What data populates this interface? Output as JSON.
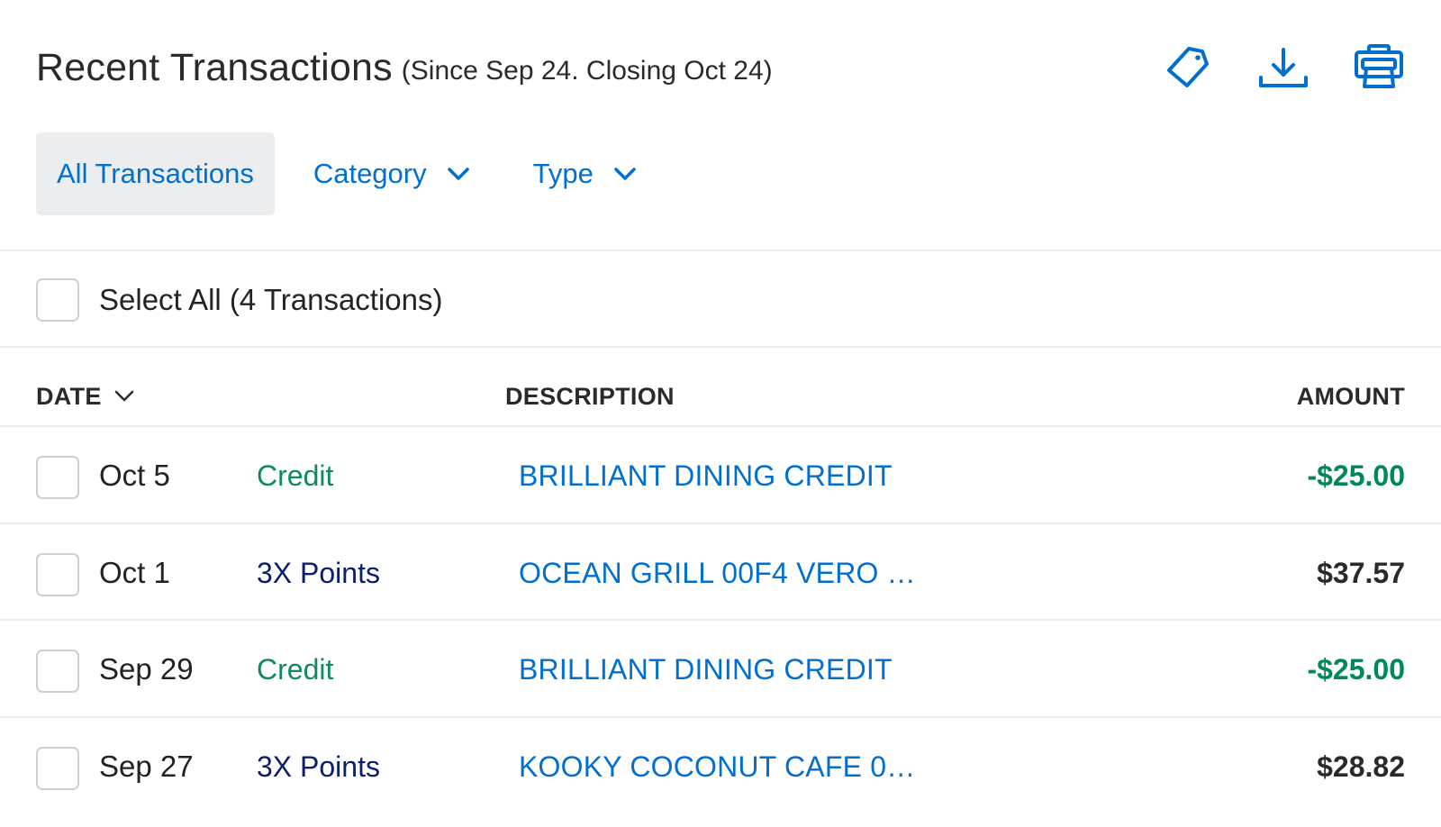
{
  "header": {
    "title": "Recent Transactions",
    "subtitle": "(Since Sep 24. Closing Oct 24)",
    "actions": [
      {
        "name": "tag-icon",
        "label": "Tag"
      },
      {
        "name": "download-icon",
        "label": "Download"
      },
      {
        "name": "print-icon",
        "label": "Print"
      }
    ]
  },
  "filters": {
    "all": "All Transactions",
    "category": "Category",
    "type": "Type"
  },
  "select_all": {
    "label": "Select All (4 Transactions)"
  },
  "table": {
    "columns": {
      "date": "DATE",
      "description": "DESCRIPTION",
      "amount": "AMOUNT"
    },
    "rows": [
      {
        "date": "Oct 5",
        "type": "Credit",
        "type_kind": "credit",
        "description": "BRILLIANT DINING CREDIT",
        "amount": "-$25.00",
        "amount_kind": "credit"
      },
      {
        "date": "Oct 1",
        "type": "3X Points",
        "type_kind": "points",
        "description": "OCEAN GRILL 00F4 VERO …",
        "amount": "$37.57",
        "amount_kind": "debit"
      },
      {
        "date": "Sep 29",
        "type": "Credit",
        "type_kind": "credit",
        "description": "BRILLIANT DINING CREDIT",
        "amount": "-$25.00",
        "amount_kind": "credit"
      },
      {
        "date": "Sep 27",
        "type": "3X Points",
        "type_kind": "points",
        "description": "KOOKY COCONUT CAFE 0…",
        "amount": "$28.82",
        "amount_kind": "debit"
      }
    ]
  },
  "colors": {
    "accent": "#006fcf",
    "credit": "#00875a",
    "points": "#0b1f6b",
    "active_filter_bg": "#ecedee"
  }
}
